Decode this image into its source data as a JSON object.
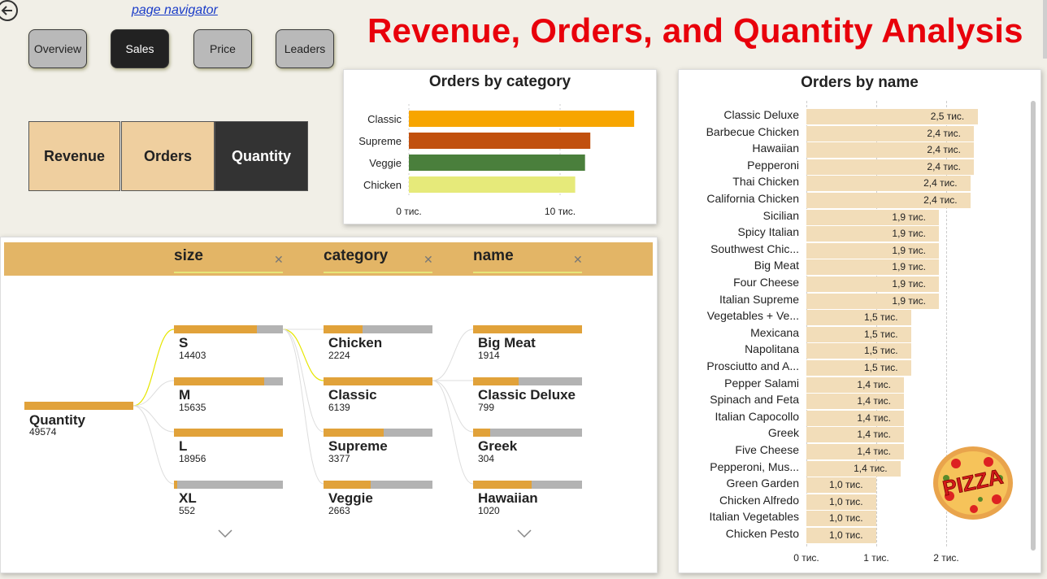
{
  "nav": {
    "link": "page navigator",
    "buttons": [
      {
        "label": "Overview",
        "active": false
      },
      {
        "label": "Sales",
        "active": true
      },
      {
        "label": "Price",
        "active": false
      },
      {
        "label": "Leaders",
        "active": false
      }
    ]
  },
  "title": "Revenue, Orders, and Quantity Analysis",
  "metrics": [
    {
      "label": "Revenue",
      "active": false
    },
    {
      "label": "Orders",
      "active": false
    },
    {
      "label": "Quantity",
      "active": true
    }
  ],
  "category_chart": {
    "title": "Orders by category",
    "x_ticks": [
      "0 тис.",
      "10 тис."
    ],
    "chart_data": {
      "type": "bar",
      "orientation": "horizontal",
      "categories": [
        "Classic",
        "Supreme",
        "Veggie",
        "Chicken"
      ],
      "values": [
        14900,
        12000,
        11650,
        11000
      ],
      "colors": [
        "#f7a500",
        "#c1500e",
        "#4a7f3c",
        "#e6ea7a"
      ],
      "xlim": [
        0,
        15000
      ]
    }
  },
  "decomposition": {
    "levels": [
      "size",
      "category",
      "name"
    ],
    "root": {
      "label": "Quantity",
      "value": "49574"
    },
    "size_nodes": [
      {
        "label": "S",
        "value": "14403",
        "fill": 0.76
      },
      {
        "label": "M",
        "value": "15635",
        "fill": 0.83
      },
      {
        "label": "L",
        "value": "18956",
        "fill": 1.0
      },
      {
        "label": "XL",
        "value": "552",
        "fill": 0.03
      }
    ],
    "category_nodes": [
      {
        "label": "Chicken",
        "value": "2224",
        "fill": 0.36
      },
      {
        "label": "Classic",
        "value": "6139",
        "fill": 1.0
      },
      {
        "label": "Supreme",
        "value": "3377",
        "fill": 0.55
      },
      {
        "label": "Veggie",
        "value": "2663",
        "fill": 0.43
      }
    ],
    "name_nodes": [
      {
        "label": "Big Meat",
        "value": "1914",
        "fill": 1.0
      },
      {
        "label": "Classic Deluxe",
        "value": "799",
        "fill": 0.42
      },
      {
        "label": "Greek",
        "value": "304",
        "fill": 0.16
      },
      {
        "label": "Hawaiian",
        "value": "1020",
        "fill": 0.54
      }
    ]
  },
  "name_chart": {
    "title": "Orders by name",
    "x_ticks": [
      "0 тис.",
      "1 тис.",
      "2 тис."
    ],
    "chart_data": {
      "type": "bar",
      "orientation": "horizontal",
      "categories": [
        "Classic Deluxe",
        "Barbecue Chicken",
        "Hawaiian",
        "Pepperoni",
        "Thai Chicken",
        "California Chicken",
        "Sicilian",
        "Spicy Italian",
        "Southwest Chic...",
        "Big Meat",
        "Four Cheese",
        "Italian Supreme",
        "Vegetables + Ve...",
        "Mexicana",
        "Napolitana",
        "Prosciutto and A...",
        "Pepper Salami",
        "Spinach and Feta",
        "Italian Capocollo",
        "Greek",
        "Five Cheese",
        "Pepperoni, Mus...",
        "Green Garden",
        "Chicken Alfredo",
        "Italian Vegetables",
        "Chicken Pesto"
      ],
      "values": [
        2450,
        2400,
        2400,
        2400,
        2350,
        2350,
        1900,
        1900,
        1900,
        1900,
        1900,
        1900,
        1500,
        1500,
        1500,
        1500,
        1400,
        1400,
        1400,
        1400,
        1400,
        1350,
        1000,
        1000,
        1000,
        1000
      ],
      "value_labels": [
        "2,5 тис.",
        "2,4 тис.",
        "2,4 тис.",
        "2,4 тис.",
        "2,4 тис.",
        "2,4 тис.",
        "1,9 тис.",
        "1,9 тис.",
        "1,9 тис.",
        "1,9 тис.",
        "1,9 тис.",
        "1,9 тис.",
        "1,5 тис.",
        "1,5 тис.",
        "1,5 тис.",
        "1,5 тис.",
        "1,4 тис.",
        "1,4 тис.",
        "1,4 тис.",
        "1,4 тис.",
        "1,4 тис.",
        "1,4 тис.",
        "1,0 тис.",
        "1,0 тис.",
        "1,0 тис.",
        "1,0 тис."
      ],
      "xlim": [
        0,
        2500
      ]
    }
  },
  "logo_text": "PIZZA"
}
